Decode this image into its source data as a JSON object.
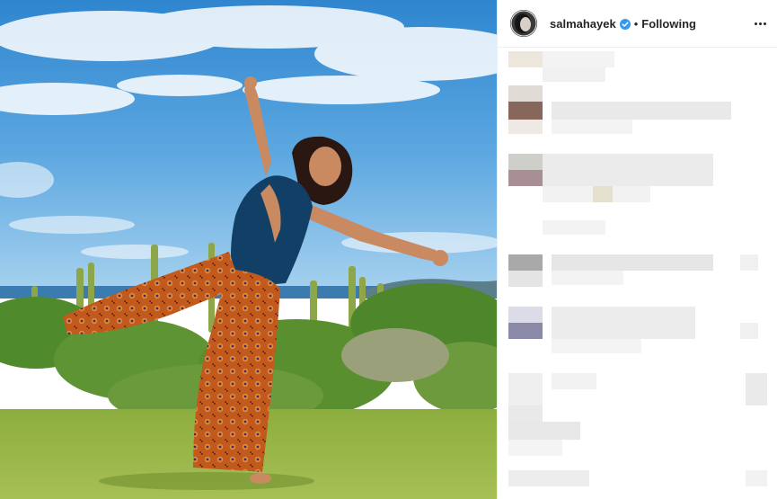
{
  "post": {
    "username": "salmahayek",
    "verified": true,
    "separator": "•",
    "follow_status": "Following"
  },
  "icons": {
    "verified": "verified-badge-icon",
    "more": "more-options-icon"
  },
  "colors": {
    "verified_blue": "#3897f0",
    "text": "#262626"
  }
}
